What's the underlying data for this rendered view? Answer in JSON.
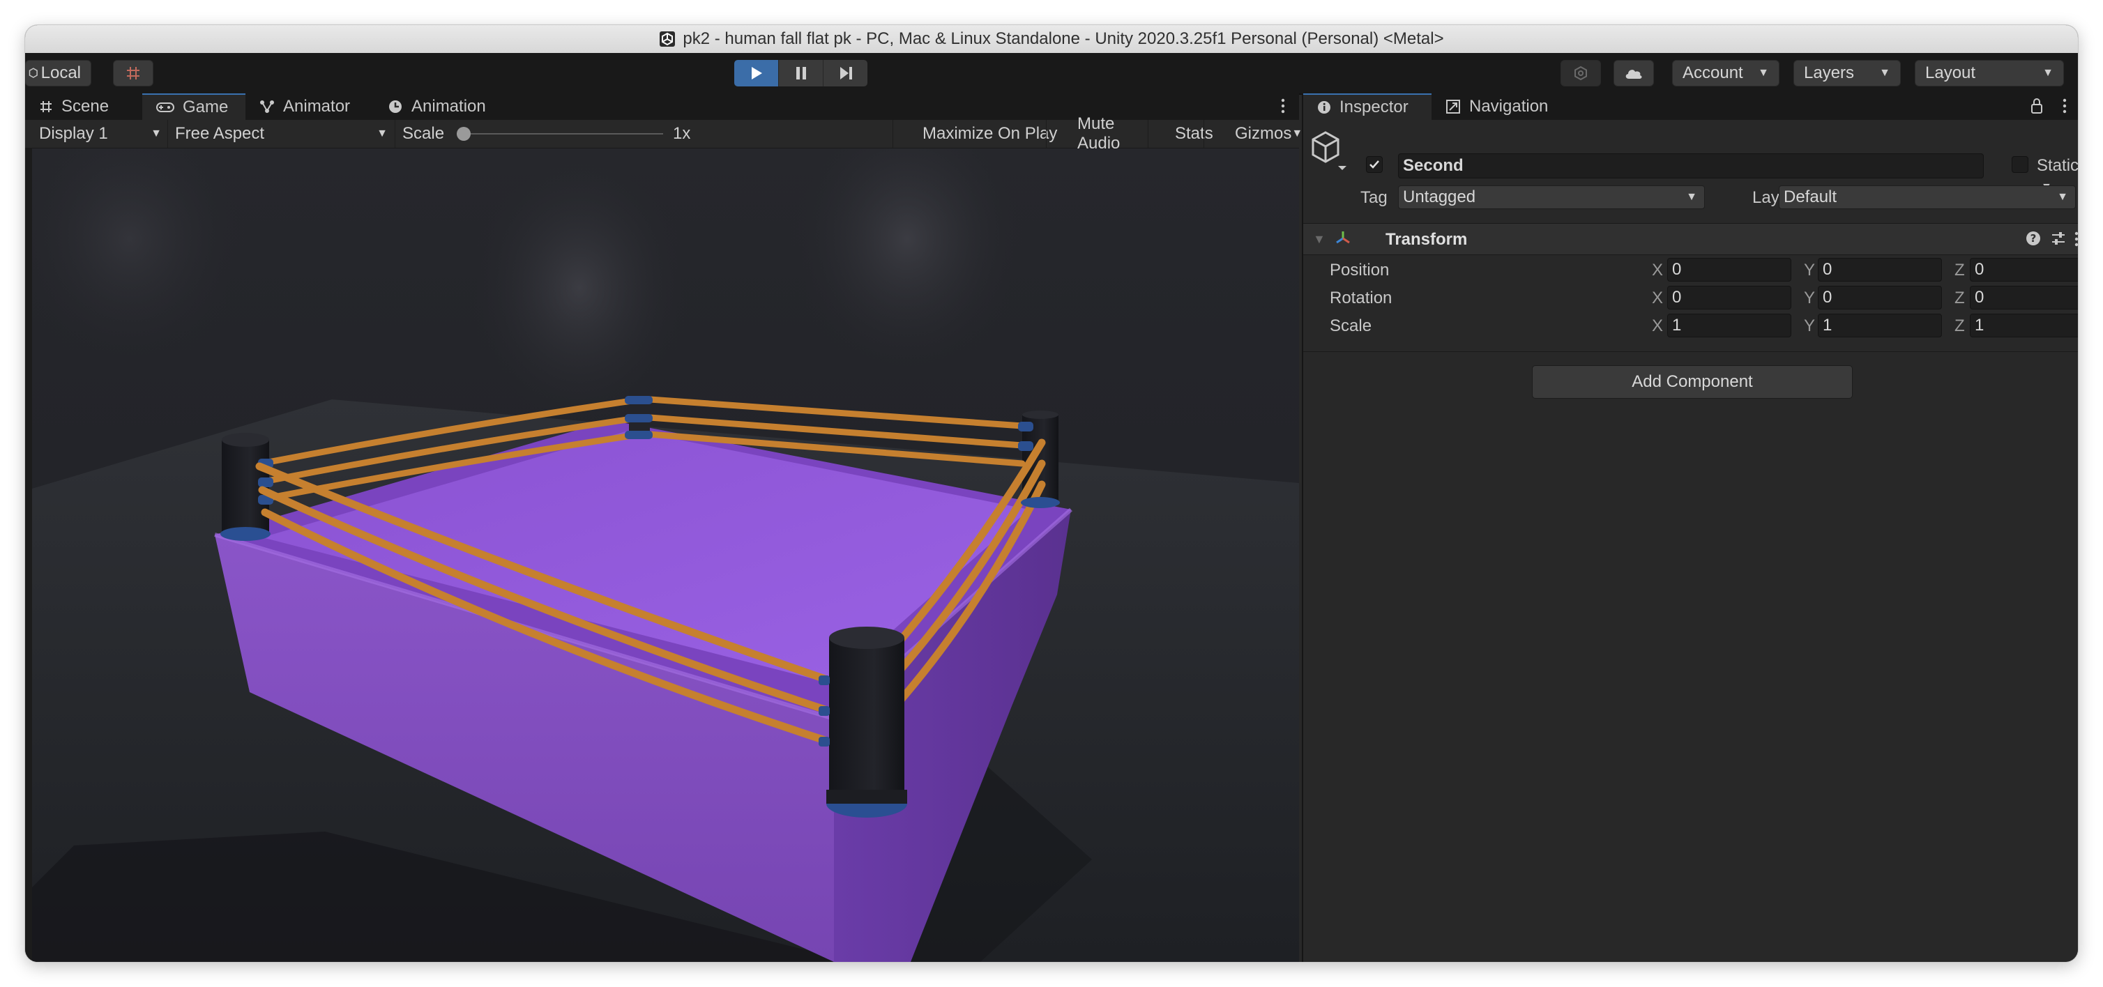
{
  "window": {
    "title": "pk2 - human fall flat pk - PC, Mac & Linux Standalone - Unity 2020.3.25f1 Personal (Personal) <Metal>"
  },
  "toolbar": {
    "local_label": "Local",
    "account_label": "Account",
    "layers_label": "Layers",
    "layout_label": "Layout",
    "play_active": true
  },
  "tabs": [
    {
      "label": "Scene",
      "icon": "grid-icon"
    },
    {
      "label": "Game",
      "icon": "gamepad-icon",
      "active": true
    },
    {
      "label": "Animator",
      "icon": "animator-icon"
    },
    {
      "label": "Animation",
      "icon": "clock-icon"
    }
  ],
  "game_bar": {
    "display": "Display 1",
    "aspect": "Free Aspect",
    "scale_label": "Scale",
    "scale_value": "1x",
    "scale_level": 0,
    "maximize": "Maximize On Play",
    "mute": "Mute Audio",
    "stats": "Stats",
    "gizmos": "Gizmos"
  },
  "inspector": {
    "tabs": [
      {
        "label": "Inspector",
        "icon": "info-icon",
        "active": true
      },
      {
        "label": "Navigation",
        "icon": "navigation-icon"
      }
    ],
    "object_name": "Second",
    "active": true,
    "static_label": "Static",
    "tag_label": "Tag",
    "tag_value": "Untagged",
    "layer_label": "Layer",
    "layer_value": "Default",
    "component_title": "Transform",
    "rows": [
      {
        "label": "Position",
        "x": "0",
        "y": "0",
        "z": "0"
      },
      {
        "label": "Rotation",
        "x": "0",
        "y": "0",
        "z": "0"
      },
      {
        "label": "Scale",
        "x": "1",
        "y": "1",
        "z": "1"
      }
    ],
    "axis_labels": {
      "x": "X",
      "y": "Y",
      "z": "Z"
    },
    "add_component": "Add Component"
  },
  "colors": {
    "accent_blue": "#3b6da8",
    "ring_purple": "#8d4fd6",
    "rope_orange": "#c6802f",
    "post_dark": "#1c1d22"
  }
}
